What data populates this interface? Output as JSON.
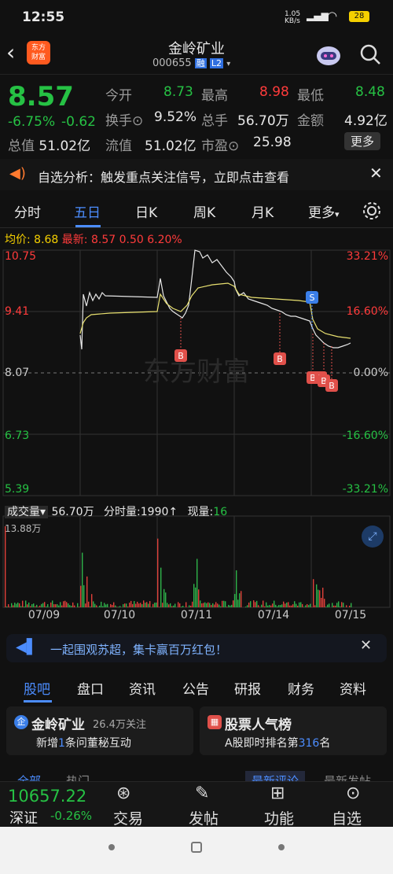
{
  "status": {
    "time": "12:55",
    "net_speed_top": "1.05",
    "net_speed_unit": "KB/s",
    "battery": "28"
  },
  "header": {
    "title": "金岭矿业",
    "code": "000655",
    "badge_rong": "融",
    "badge_l2": "L2",
    "logo_top": "东方",
    "logo_bottom": "财富"
  },
  "quote": {
    "price": "8.57",
    "change_pct": "-6.75%",
    "change": "-0.62",
    "open_label": "今开",
    "open": "8.73",
    "high_label": "最高",
    "high": "8.98",
    "low_label": "最低",
    "low": "8.48",
    "turnover_label": "换手",
    "turnover": "9.52%",
    "volume_label": "总手",
    "volume": "56.70万",
    "amount_label": "金额",
    "amount": "4.92亿",
    "mktcap_label": "总值",
    "mktcap": "51.02亿",
    "float_label": "流值",
    "float": "51.02亿",
    "pe_label": "市盈",
    "pe": "25.98",
    "more": "更多"
  },
  "alert": {
    "text": "自选分析：触发重点关注信号，立即点击查看"
  },
  "tabs": {
    "items": [
      "分时",
      "五日",
      "日K",
      "周K",
      "月K",
      "更多"
    ],
    "active": "五日"
  },
  "chart": {
    "avg_label": "均价:",
    "avg": "8.68",
    "latest_label": "最新:",
    "latest": "8.57",
    "chg": "0.50",
    "chg_pct": "6.20%",
    "y_left": [
      "10.75",
      "9.41",
      "8.07",
      "6.73",
      "5.39"
    ],
    "y_right": [
      "33.21%",
      "16.60%",
      "0.00%",
      "-16.60%",
      "-33.21%"
    ],
    "watermark": "东方财富",
    "vol_selector": "成交量",
    "vol_total": "56.70万",
    "vol_min_label": "分时量:",
    "vol_min": "1990↑",
    "vol_now_label": "现量:",
    "vol_now": "16",
    "vol_max": "13.88万",
    "dates": [
      "07/09",
      "07/10",
      "07/11",
      "07/14",
      "07/15"
    ],
    "mark_b": "B",
    "mark_s": "S"
  },
  "chart_data": {
    "type": "line",
    "x": [
      "07/09",
      "07/10",
      "07/11",
      "07/14",
      "07/15"
    ],
    "ylim": [
      5.39,
      10.75
    ],
    "baseline": 8.07,
    "series": [
      {
        "name": "最新",
        "values": [
          8.7,
          9.9,
          10.4,
          9.6,
          8.57
        ]
      },
      {
        "name": "均价",
        "values": [
          8.4,
          9.4,
          9.8,
          9.4,
          8.68
        ]
      }
    ]
  },
  "banner": {
    "text": "一起围观苏超，集卡赢百万红包！"
  },
  "guba": {
    "tabs": [
      "股吧",
      "盘口",
      "资讯",
      "公告",
      "研报",
      "财务",
      "资料"
    ],
    "active": "股吧"
  },
  "card1": {
    "title": "金岭矿业",
    "follow": "26.4万关注",
    "sub_pre": "新增",
    "sub_num": "1",
    "sub_post": "条问董秘互动"
  },
  "card2": {
    "title": "股票人气榜",
    "sub_pre": "A股即时排名第",
    "sub_num": "316",
    "sub_post": "名"
  },
  "subtabs": {
    "all": "全部",
    "hot": "热门",
    "latest_review": "最新评论",
    "latest_post": "最新发帖"
  },
  "bottom": {
    "index_value": "10657.22",
    "index_name": "深证",
    "index_chg": "-0.26%",
    "items": [
      "交易",
      "发帖",
      "功能",
      "自选"
    ]
  }
}
